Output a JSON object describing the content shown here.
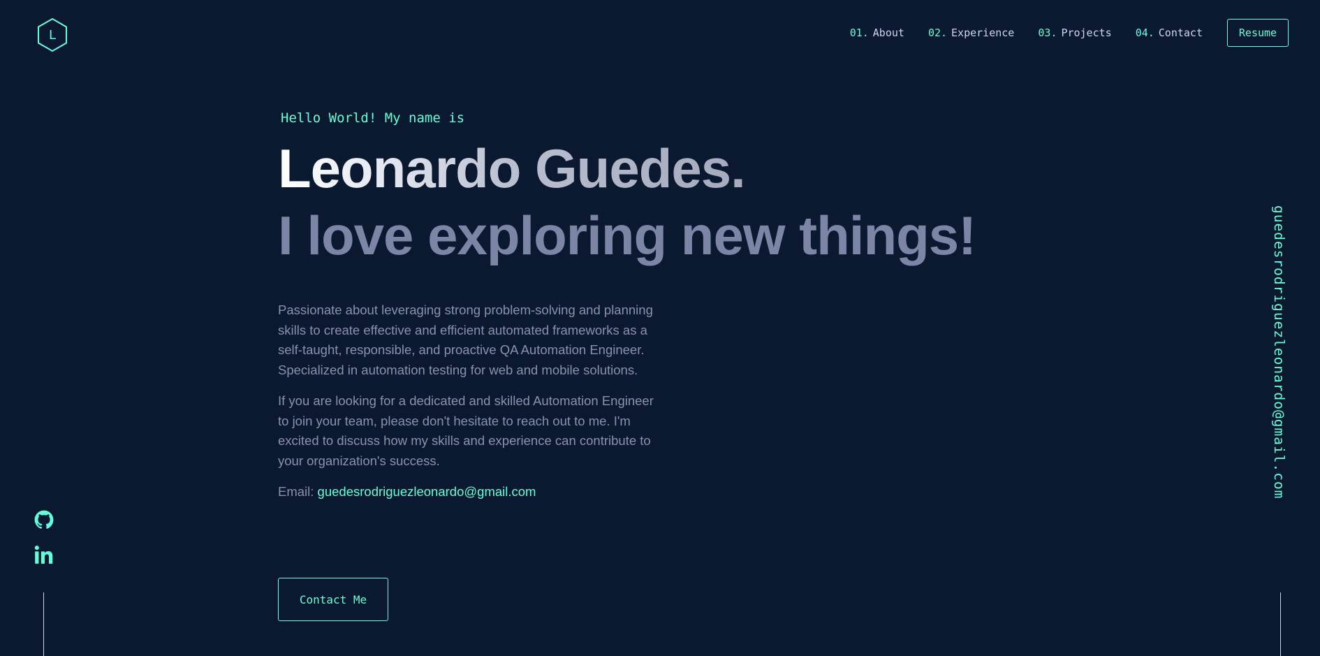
{
  "colors": {
    "background": "#0a192f",
    "accent": "#64ffda",
    "text_light": "#ccd6f6",
    "text_muted": "#8892b0"
  },
  "header": {
    "logo_letter": "L",
    "nav": [
      {
        "num": "01.",
        "label": "About"
      },
      {
        "num": "02.",
        "label": "Experience"
      },
      {
        "num": "03.",
        "label": "Projects"
      },
      {
        "num": "04.",
        "label": "Contact"
      }
    ],
    "resume_label": "Resume"
  },
  "hero": {
    "greeting": "Hello World! My name is",
    "name": "Leonardo Guedes.",
    "tagline": "I love exploring new things!",
    "bio": [
      "Passionate about leveraging strong problem-solving and planning skills to create effective and efficient automated frameworks as a self-taught, responsible, and proactive QA Automation Engineer. Specialized in automation testing for web and mobile solutions.",
      "If you are looking for a dedicated and skilled Automation Engineer to join your team, please don't hesitate to reach out to me. I'm excited to discuss how my skills and experience can contribute to your organization's success."
    ],
    "email_label": "Email:",
    "email": "guedesrodriguezleonardo@gmail.com",
    "contact_button": "Contact Me"
  },
  "social": [
    {
      "icon": "github-icon"
    },
    {
      "icon": "linkedin-icon"
    }
  ],
  "side_email": "guedesrodriguezleonardo@gmail.com"
}
